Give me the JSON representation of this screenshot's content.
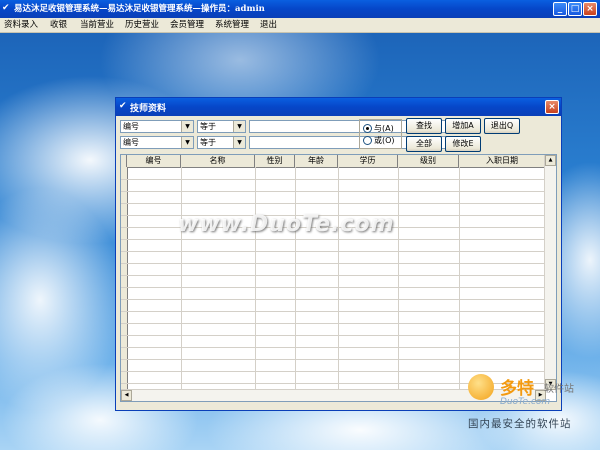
{
  "app": {
    "title": "易达沐足收银管理系统—易达沐足收银管理系统—操作员：admin",
    "window_buttons": {
      "minimize": "_",
      "maximize": "□",
      "close": "×"
    }
  },
  "menubar": {
    "items": [
      "资料录入",
      "收银",
      "当前营业",
      "历史营业",
      "会员管理",
      "系统管理",
      "退出"
    ]
  },
  "dialog": {
    "title": "技师资料",
    "close": "×",
    "filters": [
      {
        "field": "编号",
        "operator": "等于",
        "value": ""
      },
      {
        "field": "编号",
        "operator": "等于",
        "value": ""
      }
    ],
    "logic": {
      "and_label": "与(A)",
      "or_label": "或(O)",
      "selected": "and"
    },
    "buttons": {
      "search": "查找",
      "add": "增加A",
      "exit": "退出Q",
      "all": "全部",
      "edit": "修改E"
    },
    "grid": {
      "columns": [
        "编号",
        "名称",
        "性别",
        "年龄",
        "学历",
        "级别",
        "入职日期"
      ],
      "rows": []
    }
  },
  "watermark": {
    "text": "www.DuoTe.com",
    "logo_name": "多特",
    "logo_sub": "软件站",
    "logo_url": "DuoTe.com",
    "logo_tagline": "国内最安全的软件站"
  },
  "colors": {
    "titlebar": "#0646c8",
    "dialog_bg": "#ece9d8",
    "close_button": "#c8401c",
    "logo_orange": "#f39a10"
  }
}
